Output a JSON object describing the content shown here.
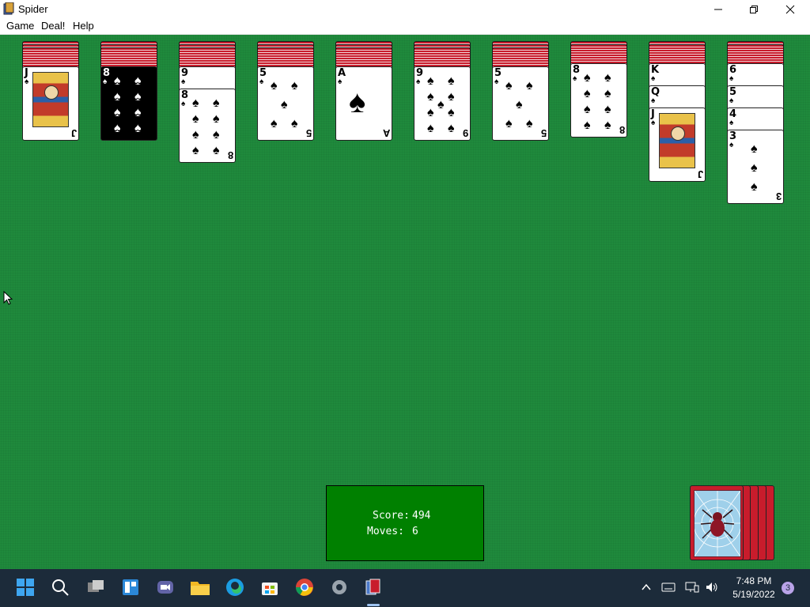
{
  "window": {
    "title": "Spider",
    "icon": "spider-app-icon"
  },
  "menu": {
    "items": [
      "Game",
      "Deal!",
      "Help"
    ]
  },
  "tableau": [
    {
      "backs": 3,
      "cards": [
        {
          "rank": "J",
          "suit": "♠"
        }
      ]
    },
    {
      "backs": 3,
      "cards": [
        {
          "rank": "8",
          "suit": "♠",
          "selected": true
        }
      ]
    },
    {
      "backs": 3,
      "cards": [
        {
          "rank": "9",
          "suit": "♠"
        },
        {
          "rank": "8",
          "suit": "♠"
        }
      ]
    },
    {
      "backs": 3,
      "cards": [
        {
          "rank": "5",
          "suit": "♠"
        }
      ]
    },
    {
      "backs": 3,
      "cards": [
        {
          "rank": "A",
          "suit": "♠"
        }
      ]
    },
    {
      "backs": 3,
      "cards": [
        {
          "rank": "9",
          "suit": "♠"
        }
      ]
    },
    {
      "backs": 3,
      "cards": [
        {
          "rank": "5",
          "suit": "♠"
        }
      ]
    },
    {
      "backs": 2,
      "cards": [
        {
          "rank": "8",
          "suit": "♠"
        }
      ]
    },
    {
      "backs": 2,
      "cards": [
        {
          "rank": "K",
          "suit": "♠"
        },
        {
          "rank": "Q",
          "suit": "♠"
        },
        {
          "rank": "J",
          "suit": "♠"
        }
      ]
    },
    {
      "backs": 2,
      "cards": [
        {
          "rank": "6",
          "suit": "♠"
        },
        {
          "rank": "5",
          "suit": "♠"
        },
        {
          "rank": "4",
          "suit": "♠"
        },
        {
          "rank": "3",
          "suit": "♠"
        }
      ]
    }
  ],
  "status": {
    "score_label": "Score:",
    "score_value": "494",
    "moves_label": "Moves:",
    "moves_value": "6"
  },
  "stock": {
    "remaining_deals": 5
  },
  "taskbar": {
    "icons": [
      "start-icon",
      "search-icon",
      "task-view-icon",
      "widgets-icon",
      "teams-chat-icon",
      "file-explorer-icon",
      "edge-icon",
      "store-icon",
      "chrome-icon",
      "settings-icon",
      "spider-icon"
    ],
    "time": "7:48 PM",
    "date": "5/19/2022",
    "notifications": "3"
  },
  "colors": {
    "felt": "#1f8a3c",
    "score_box": "#008000",
    "card_back": "#c81c2c",
    "taskbar": "#1c2b3a"
  }
}
